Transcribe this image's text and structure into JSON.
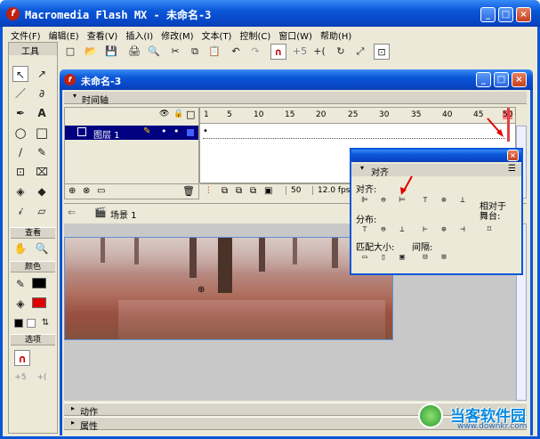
{
  "app": {
    "title": "Macromedia Flash MX - 未命名-3",
    "min": "_",
    "max": "□",
    "close": "×"
  },
  "menu": [
    "文件(F)",
    "编辑(E)",
    "查看(V)",
    "插入(I)",
    "修改(M)",
    "文本(T)",
    "控制(C)",
    "窗口(W)",
    "帮助(H)"
  ],
  "toolbar": [
    "□",
    "📂",
    "💾",
    "🖨",
    "🔍",
    "✂",
    "⧉",
    "📋",
    "↶",
    "↷",
    "∩",
    "+5",
    "+(",
    "↻",
    "⤢",
    "⊡"
  ],
  "tools": {
    "title": "工具",
    "view_label": "查看",
    "color_label": "颜色",
    "options_label": "选项",
    "icons": [
      "↖",
      "↗",
      "／",
      "∂",
      "✒",
      "A",
      "○",
      "□",
      "∕",
      "✎",
      "⊡",
      "⌧",
      "◈",
      "◆",
      "𝒾",
      "▱"
    ],
    "view_icons": [
      "✋",
      "🔍"
    ],
    "opt_icons": [
      "∩",
      "+5",
      "+("
    ]
  },
  "doc": {
    "title": "未命名-3",
    "min": "_",
    "max": "□",
    "close": "×"
  },
  "timeline": {
    "label": "时间轴",
    "layer": "图层 1",
    "ticks": [
      "1",
      "5",
      "10",
      "15",
      "20",
      "25",
      "30",
      "35",
      "40",
      "45",
      "50"
    ],
    "fps_frame": "50",
    "fps": "12.0 fps",
    "hdr_icons": [
      "👁",
      "🔒",
      "□"
    ]
  },
  "scene": {
    "label": "场景 1",
    "back": "⇐"
  },
  "panels": {
    "actions": "动作",
    "properties": "属性"
  },
  "align": {
    "title": "对齐",
    "align_label": "对齐:",
    "distribute_label": "分布:",
    "match_label": "匹配大小:",
    "spacing_label": "间隔:",
    "relative_label": "相对于",
    "stage_label": "舞台:",
    "row1": [
      "⊫",
      "⊜",
      "⊨",
      "⊤",
      "⊕",
      "⊥"
    ],
    "row2": [
      "⊤",
      "⊜",
      "⊥",
      "⊢",
      "⊕",
      "⊣"
    ],
    "row3": [
      "▭",
      "▯",
      "▣"
    ],
    "row3b": [
      "⊟",
      "⊞"
    ],
    "stage_icon": "⌑"
  },
  "watermark": {
    "name": "当客软件园",
    "url": "www.downkr.com"
  },
  "colors": {
    "stroke": "#000000",
    "fill": "#e00000"
  }
}
